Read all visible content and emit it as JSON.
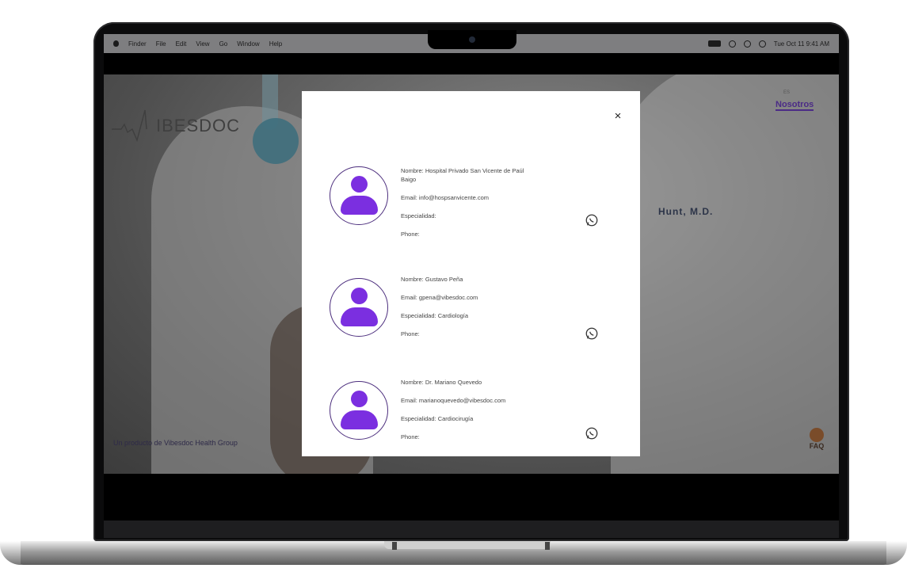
{
  "menubar": {
    "items": [
      "Finder",
      "File",
      "Edit",
      "View",
      "Go",
      "Window",
      "Help"
    ],
    "clock": "Tue Oct 11 9:41 AM"
  },
  "site": {
    "logo_text": "IBESDOC",
    "top_label": "ES",
    "top_link": "Nosotros",
    "footer_text": "Un producto de Vibesdoc Health Group",
    "faq_label": "FAQ",
    "name_tag": "Hunt, M.D.",
    "accent_color": "#7b2fe0"
  },
  "modal": {
    "close_label": "×",
    "contacts": [
      {
        "name_line": "Nombre: Hospital Privado San Vicente de Paúl",
        "name_line2": "Baigo",
        "email_line": "Email: info@hospsanvicente.com",
        "specialty_line": "Especialidad:",
        "phone_line": "Phone:",
        "action_icon": "whatsapp-icon"
      },
      {
        "name_line": "Nombre: Gustavo Peña",
        "email_line": "Email: gpena@vibesdoc.com",
        "specialty_line": "Especialidad: Cardiología",
        "phone_line": "Phone:",
        "action_icon": "whatsapp-icon"
      },
      {
        "name_line": "Nombre: Dr. Mariano Quevedo",
        "email_line": "Email: marianoquevedo@vibesdoc.com",
        "specialty_line": "Especialidad: Cardiocirugía",
        "phone_line": "Phone:",
        "action_icon": "whatsapp-icon"
      }
    ]
  }
}
